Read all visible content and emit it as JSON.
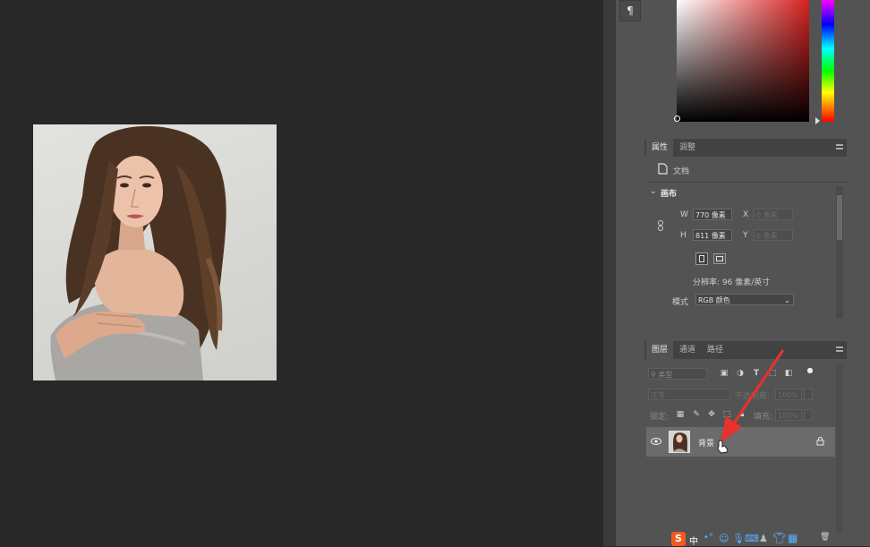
{
  "properties_panel": {
    "tabs": [
      {
        "label": "属性"
      },
      {
        "label": "调整"
      }
    ],
    "doc_label": "文档",
    "canvas_section": "画布",
    "width_label": "W",
    "width_value": "770 像素",
    "height_label": "H",
    "height_value": "811 像素",
    "x_label": "X",
    "x_value": "0 像素",
    "y_label": "Y",
    "y_value": "0 像素",
    "resolution_text": "分辨率: 96 像素/英寸",
    "mode_label": "模式",
    "mode_value": "RGB 颜色"
  },
  "layers_panel": {
    "tabs": [
      {
        "label": "图层"
      },
      {
        "label": "通道"
      },
      {
        "label": "路径"
      }
    ],
    "filter_placeholder": "类型",
    "blend_mode": "正常",
    "opacity_label": "不透明度:",
    "opacity_value": "100%",
    "lock_label": "锁定:",
    "fill_label": "填充:",
    "fill_value": "100%",
    "layers": [
      {
        "name": "背景",
        "visible": true,
        "locked": true
      }
    ]
  },
  "taskbar": {
    "ime_label": "中"
  },
  "colors": {
    "canvas_bg": "#282828",
    "panel_bg": "#535353",
    "annotation_arrow": "#e8322c",
    "selected_layer": "#6b6b6b"
  }
}
